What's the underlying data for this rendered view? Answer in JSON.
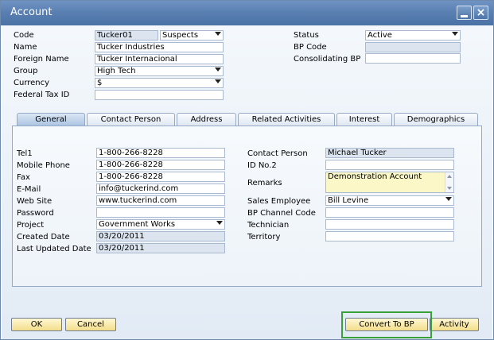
{
  "window": {
    "title": "Account"
  },
  "header": {
    "code_label": "Code",
    "code_value": "Tucker01",
    "code_type": "Suspects",
    "name_label": "Name",
    "name_value": "Tucker Industries",
    "foreign_label": "Foreign Name",
    "foreign_value": "Tucker Internacional",
    "group_label": "Group",
    "group_value": "High Tech",
    "currency_label": "Currency",
    "currency_value": "$",
    "tax_label": "Federal Tax ID",
    "tax_value": "",
    "status_label": "Status",
    "status_value": "Active",
    "bpcode_label": "BP Code",
    "bpcode_value": "",
    "consol_label": "Consolidating BP",
    "consol_value": ""
  },
  "tabs": [
    "General",
    "Contact Person",
    "Address",
    "Related Activities",
    "Interest",
    "Demographics"
  ],
  "general": {
    "tel1_label": "Tel1",
    "tel1_value": "1-800-266-8228",
    "mobile_label": "Mobile Phone",
    "mobile_value": "1-800-266-8228",
    "fax_label": "Fax",
    "fax_value": "1-800-266-8228",
    "email_label": "E-Mail",
    "email_value": "info@tuckerind.com",
    "web_label": "Web Site",
    "web_value": "www.tuckerind.com",
    "password_label": "Password",
    "password_value": "",
    "project_label": "Project",
    "project_value": "Government Works",
    "created_label": "Created Date",
    "created_value": "03/20/2011",
    "updated_label": "Last Updated Date",
    "updated_value": "03/20/2011",
    "contact_label": "Contact Person",
    "contact_value": "Michael Tucker",
    "id2_label": "ID No.2",
    "id2_value": "",
    "remarks_label": "Remarks",
    "remarks_value": "Demonstration Account",
    "sales_label": "Sales Employee",
    "sales_value": "Bill Levine",
    "channel_label": "BP Channel Code",
    "channel_value": "",
    "tech_label": "Technician",
    "tech_value": "",
    "territory_label": "Territory",
    "territory_value": ""
  },
  "buttons": {
    "ok": "OK",
    "cancel": "Cancel",
    "convert": "Convert To BP",
    "activity": "Activity"
  }
}
